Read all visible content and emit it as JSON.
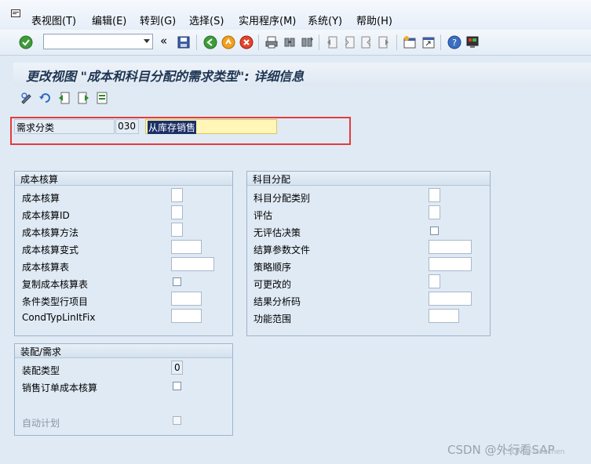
{
  "menu": {
    "items": [
      "表视图(T)",
      "编辑(E)",
      "转到(G)",
      "选择(S)",
      "实用程序(M)",
      "系统(Y)",
      "帮助(H)"
    ]
  },
  "toolbar": {
    "command_field_value": "",
    "icons": [
      "check-icon",
      "command-field",
      "back-arrows",
      "save-icon",
      "back-icon",
      "exit-icon",
      "cancel-icon",
      "print-icon",
      "find-icon",
      "find-next-icon",
      "first-page-icon",
      "prev-page-icon",
      "next-page-icon",
      "last-page-icon",
      "new-session-icon",
      "shortcut-icon",
      "help-icon",
      "customize-icon"
    ],
    "double_left": "«"
  },
  "title": "更改视图 \"成本和科目分配的需求类型\": 详细信息",
  "header_field": {
    "label": "需求分类",
    "value": "030",
    "description": "从库存销售"
  },
  "cost_group": {
    "title": "成本核算",
    "rows": [
      {
        "label": "成本核算",
        "type": "small"
      },
      {
        "label": "成本核算ID",
        "type": "small"
      },
      {
        "label": "成本核算方法",
        "type": "small"
      },
      {
        "label": "成本核算变式",
        "type": "medium"
      },
      {
        "label": "成本核算表",
        "type": "wide"
      },
      {
        "label": "复制成本核算表",
        "type": "checkbox"
      },
      {
        "label": "条件类型行项目",
        "type": "medium"
      },
      {
        "label": "CondTypLinItFix",
        "type": "medium"
      }
    ]
  },
  "account_group": {
    "title": "科目分配",
    "rows": [
      {
        "label": "科目分配类别",
        "type": "small"
      },
      {
        "label": "评估",
        "type": "small"
      },
      {
        "label": "无评估决策",
        "type": "checkbox"
      },
      {
        "label": "结算参数文件",
        "type": "wide"
      },
      {
        "label": "策略顺序",
        "type": "wide"
      },
      {
        "label": "可更改的",
        "type": "small"
      },
      {
        "label": "结果分析码",
        "type": "wide"
      },
      {
        "label": "功能范围",
        "type": "medium"
      }
    ]
  },
  "assembly_group": {
    "title": "装配/需求",
    "assembly_type_label": "装配类型",
    "assembly_type_value": "0",
    "sales_order_costing_label": "销售订单成本核算",
    "auto_planning_label": "自动计划"
  },
  "watermark": "CSDN @外行看SAP",
  "watermark_sub": "CSDN @Takuchen",
  "colors": {
    "highlight_box": "#e53b3b",
    "description_bg": "#fff6b8",
    "selection_bg": "#1b2f66",
    "title_text": "#1e3552"
  }
}
